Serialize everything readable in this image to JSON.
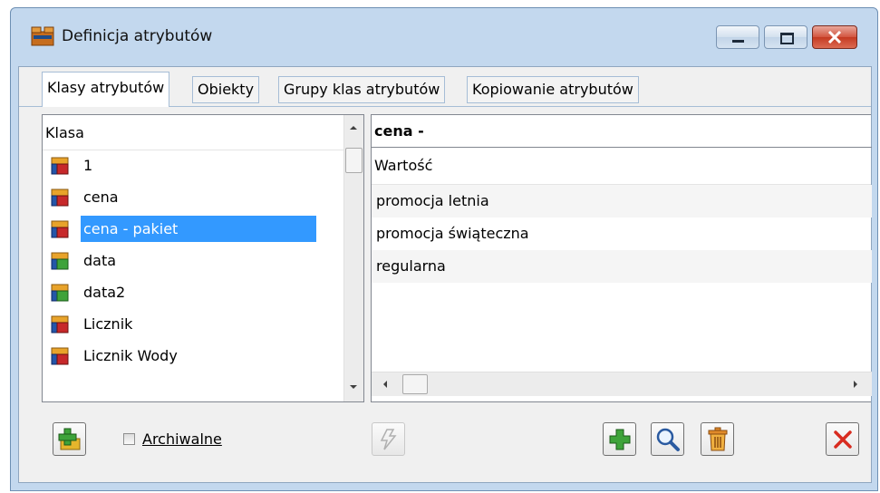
{
  "window": {
    "title": "Definicja atrybutów",
    "controls": {
      "minimize": "minimize-icon",
      "maximize": "maximize-icon",
      "close": "close-icon"
    }
  },
  "tabs": [
    {
      "label": "Klasy atrybutów",
      "active": true
    },
    {
      "label": "Obiekty",
      "active": false
    },
    {
      "label": "Grupy klas atrybutów",
      "active": false
    },
    {
      "label": "Kopiowanie atrybutów",
      "active": false
    }
  ],
  "left_list": {
    "header": "Klasa",
    "items": [
      {
        "label": "1",
        "selected": false
      },
      {
        "label": "cena",
        "selected": false
      },
      {
        "label": "cena - pakiet",
        "selected": true
      },
      {
        "label": "data",
        "selected": false
      },
      {
        "label": "data2",
        "selected": false
      },
      {
        "label": "Licznik",
        "selected": false
      },
      {
        "label": "Licznik Wody",
        "selected": false
      }
    ]
  },
  "right_pane": {
    "title": "cena -",
    "header": "Wartość",
    "rows": [
      "promocja letnia",
      "promocja świąteczna",
      "regularna"
    ]
  },
  "bottom": {
    "archive_checkbox": {
      "label": "Archiwalne",
      "checked": false
    }
  },
  "icons": {
    "add_class": "add-folder-icon",
    "disabled_action": "lightning-icon",
    "add": "plus-icon",
    "view": "magnifier-icon",
    "delete": "trash-icon",
    "close": "close-x-icon"
  },
  "colors": {
    "selection": "#3399ff",
    "window_frame": "#c3d8ee",
    "close_button": "#c43a22",
    "add_green": "#3ea33a",
    "delete_red": "#d82c20"
  }
}
